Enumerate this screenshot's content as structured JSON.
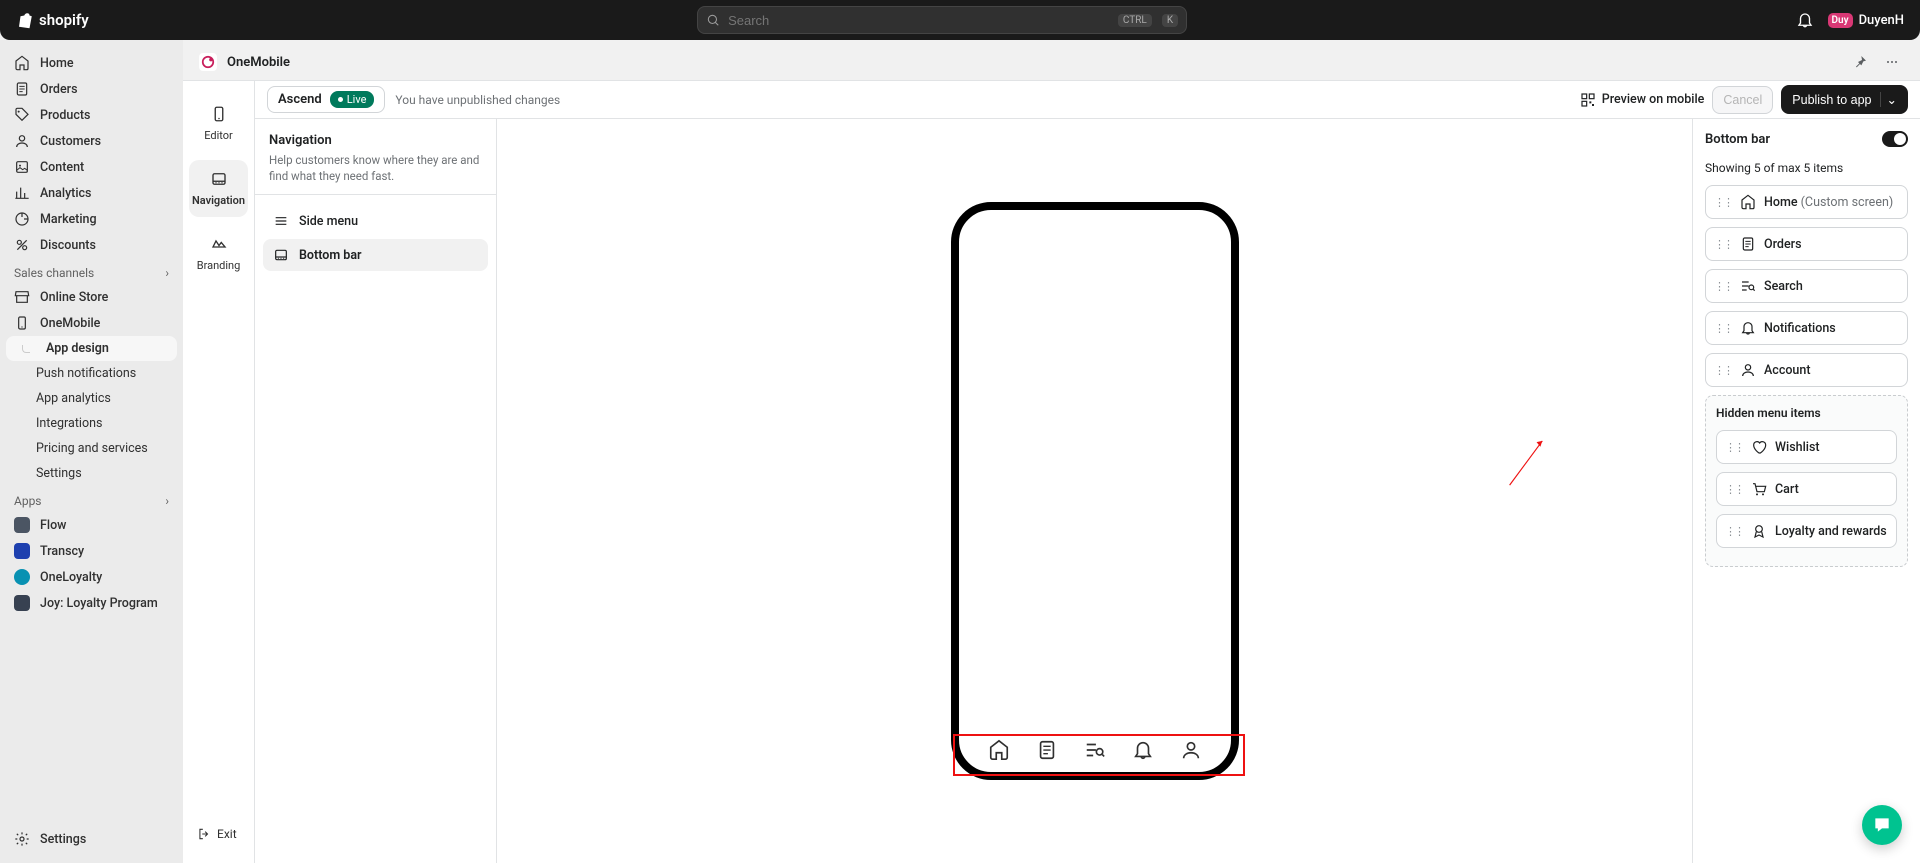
{
  "topbar": {
    "brand": "shopify",
    "search_placeholder": "Search",
    "kbd1": "CTRL",
    "kbd2": "K",
    "avatar_initials": "Duy",
    "username": "DuyenH"
  },
  "left_nav": {
    "items": [
      {
        "icon": "home",
        "label": "Home"
      },
      {
        "icon": "orders",
        "label": "Orders"
      },
      {
        "icon": "products",
        "label": "Products"
      },
      {
        "icon": "customers",
        "label": "Customers"
      },
      {
        "icon": "content",
        "label": "Content"
      },
      {
        "icon": "analytics",
        "label": "Analytics"
      },
      {
        "icon": "marketing",
        "label": "Marketing"
      },
      {
        "icon": "discounts",
        "label": "Discounts"
      }
    ],
    "section_sales": "Sales channels",
    "sales_items": [
      {
        "icon": "store",
        "label": "Online Store"
      },
      {
        "icon": "mobile",
        "label": "OneMobile",
        "active": true
      }
    ],
    "sub_items": [
      {
        "label": "App design",
        "active": true
      },
      {
        "label": "Push notifications"
      },
      {
        "label": "App analytics"
      },
      {
        "label": "Integrations"
      },
      {
        "label": "Pricing and services"
      },
      {
        "label": "Settings"
      }
    ],
    "section_apps": "Apps",
    "apps_items": [
      {
        "icon": "flow",
        "label": "Flow"
      },
      {
        "icon": "transcy",
        "label": "Transcy"
      },
      {
        "icon": "loyalty",
        "label": "OneLoyalty"
      },
      {
        "icon": "joy",
        "label": "Joy: Loyalty Program"
      }
    ],
    "settings": "Settings"
  },
  "app_header": {
    "title": "OneMobile"
  },
  "secondary_sidebar": {
    "items": [
      {
        "label": "Editor"
      },
      {
        "label": "Navigation",
        "active": true
      },
      {
        "label": "Branding"
      }
    ],
    "exit": "Exit"
  },
  "action_bar": {
    "theme": "Ascend",
    "status": "Live",
    "note": "You have unpublished changes",
    "preview": "Preview on mobile",
    "cancel": "Cancel",
    "publish": "Publish to app"
  },
  "nav_panel": {
    "title": "Navigation",
    "desc": "Help customers know where they are and find what they need fast.",
    "items": [
      {
        "label": "Side menu"
      },
      {
        "label": "Bottom bar",
        "active": true
      }
    ]
  },
  "right_panel": {
    "title": "Bottom bar",
    "count_text": "Showing 5 of max 5 items",
    "items": [
      {
        "icon": "home",
        "label": "Home",
        "sub": "(Custom screen)"
      },
      {
        "icon": "orders",
        "label": "Orders"
      },
      {
        "icon": "search",
        "label": "Search"
      },
      {
        "icon": "bell",
        "label": "Notifications"
      },
      {
        "icon": "account",
        "label": "Account"
      }
    ],
    "hidden_title": "Hidden menu items",
    "hidden_items": [
      {
        "icon": "heart",
        "label": "Wishlist"
      },
      {
        "icon": "cart",
        "label": "Cart"
      },
      {
        "icon": "rewards",
        "label": "Loyalty and rewards"
      }
    ]
  },
  "phone_icons": [
    "home",
    "orders",
    "search",
    "bell",
    "account"
  ]
}
